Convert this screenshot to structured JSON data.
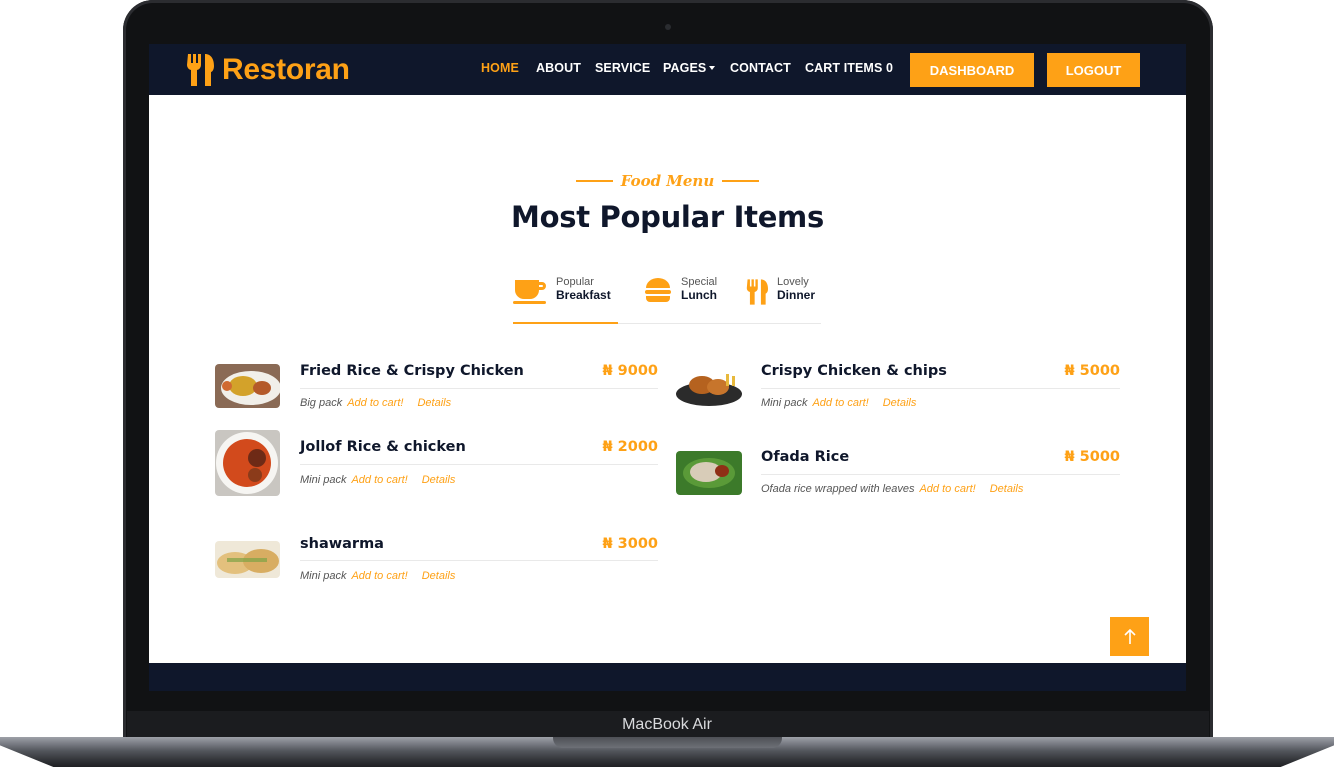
{
  "device": {
    "model_label": "MacBook Air"
  },
  "navbar": {
    "brand": "Restoran",
    "links": [
      {
        "label": "HOME",
        "active": true
      },
      {
        "label": "ABOUT"
      },
      {
        "label": "SERVICE"
      },
      {
        "label": "PAGES"
      },
      {
        "label": "CONTACT"
      },
      {
        "label": "CART ITEMS 0"
      }
    ],
    "dashboard_label": "DASHBOARD",
    "logout_label": "LOGOUT"
  },
  "section": {
    "subtitle": "Food Menu",
    "title": "Most Popular Items"
  },
  "tabs": [
    {
      "small": "Popular",
      "big": "Breakfast",
      "icon": "coffee-cup-icon",
      "active": true
    },
    {
      "small": "Special",
      "big": "Lunch",
      "icon": "burger-icon"
    },
    {
      "small": "Lovely",
      "big": "Dinner",
      "icon": "utensils-icon"
    }
  ],
  "menu": {
    "add_to_cart": "Add to cart!",
    "details": "Details",
    "left": [
      {
        "name": "Fried Rice & Crispy Chicken",
        "price": "₦ 9000",
        "desc": "Big pack"
      },
      {
        "name": "Jollof Rice & chicken",
        "price": "₦ 2000",
        "desc": "Mini pack"
      },
      {
        "name": "shawarma",
        "price": "₦ 3000",
        "desc": "Mini pack"
      }
    ],
    "right": [
      {
        "name": "Crispy Chicken & chips",
        "price": "₦ 5000",
        "desc": "Mini pack"
      },
      {
        "name": "Ofada Rice",
        "price": "₦ 5000",
        "desc": "Ofada rice wrapped with leaves"
      }
    ]
  },
  "colors": {
    "accent": "#fea116",
    "dark": "#0f172b"
  },
  "back_to_top": {
    "icon": "arrow-up-icon"
  }
}
